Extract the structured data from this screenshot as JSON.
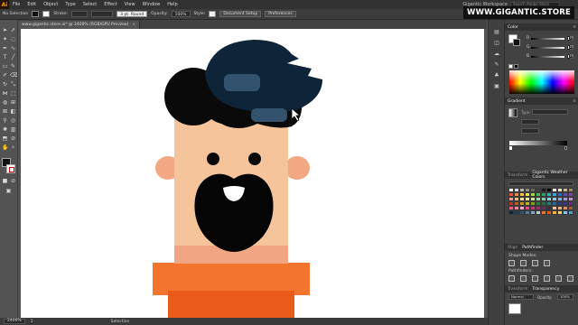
{
  "app": {
    "logo": "Ai",
    "menu": [
      "File",
      "Edit",
      "Object",
      "Type",
      "Select",
      "Effect",
      "View",
      "Window",
      "Help"
    ],
    "workspace": "Gigantic Workspace",
    "search_placeholder": "Search Adobe Stock",
    "watermark": "WWW.GIGANTIC.STORE"
  },
  "control_bar": {
    "selection": "No Selection",
    "stroke_label": "Stroke:",
    "brush": "3 pt. Round",
    "opacity_label": "Opacity:",
    "opacity_value": "100%",
    "style_label": "Style:",
    "document_setup": "Document Setup",
    "preferences": "Preferences"
  },
  "document_tab": {
    "title": "www.gigantic.store.ai* @ 2400% (RGB/GPU Preview)",
    "close": "×"
  },
  "status_bar": {
    "zoom": "2400%",
    "artboard": "1",
    "tool": "Selection"
  },
  "panels": {
    "color": {
      "title": "Color",
      "labels": [
        "R",
        "G",
        "B"
      ],
      "values": [
        "255",
        "255",
        "255"
      ]
    },
    "gradient": {
      "title": "Gradient",
      "type_label": "Type:"
    },
    "swatches": {
      "tab1": "Transform",
      "tab2": "Gigantic Weather Colors"
    },
    "pathfinder": {
      "tab1": "Align",
      "tab2": "Pathfinder",
      "shape_modes": "Shape Modes:",
      "pathfinders": "Pathfinders:"
    },
    "transparency": {
      "tab1": "Transform",
      "tab2": "Transparency",
      "mode": "Normal",
      "opacity_label": "Opacity:",
      "opacity_value": "100%"
    }
  },
  "colors": {
    "skin": "#f6c49a",
    "ear": "#f2a882",
    "neck": "#f1a582",
    "hair": "#0a0a0a",
    "cap": "#0e2438",
    "cap_highlight": "#32526d",
    "shirt_light": "#f3742c",
    "shirt_dark": "#e95a1b",
    "beard": "#050505"
  },
  "swatch_colors": [
    "#ffffff",
    "#d9d9d9",
    "#b3b3b3",
    "#8c8c8c",
    "#666666",
    "#404040",
    "#1a1a1a",
    "#000000",
    "#f7f3e8",
    "#e8e0c8",
    "#c9b98a",
    "#a0875a",
    "#e8503a",
    "#f08a3c",
    "#f7c242",
    "#f3e24c",
    "#a8d64a",
    "#4fb448",
    "#2f9e6e",
    "#34b4a8",
    "#3aa6d8",
    "#3468c8",
    "#5a4cb8",
    "#8a44b0",
    "#f29b9b",
    "#f5b98a",
    "#f9dc95",
    "#f6ef9c",
    "#cce79a",
    "#9fd79a",
    "#86cdb0",
    "#8dd6d0",
    "#92cbe9",
    "#92a9e0",
    "#a89ad8",
    "#c491d2",
    "#b8322a",
    "#c4581e",
    "#c9921e",
    "#c9b61e",
    "#7fa21e",
    "#2f7e2e",
    "#1f6e4e",
    "#1f7e76",
    "#1f6e9e",
    "#1f3e8e",
    "#3a2e8e",
    "#622a82",
    "#ff5a7a",
    "#ff7fa0",
    "#ffa4c0",
    "#e6468a",
    "#c43878",
    "#9e2c66",
    "#6e2c5a",
    "#3e2c4e",
    "#f6c49a",
    "#f2a882",
    "#e08a60",
    "#a85a38",
    "#0e2438",
    "#1f3e5e",
    "#32526d",
    "#5a7a94",
    "#8aa6bc",
    "#b8cad8",
    "#f3742c",
    "#e95a1b",
    "#f9b23c",
    "#fcd16a",
    "#7bc6e8",
    "#4a9fd0"
  ]
}
